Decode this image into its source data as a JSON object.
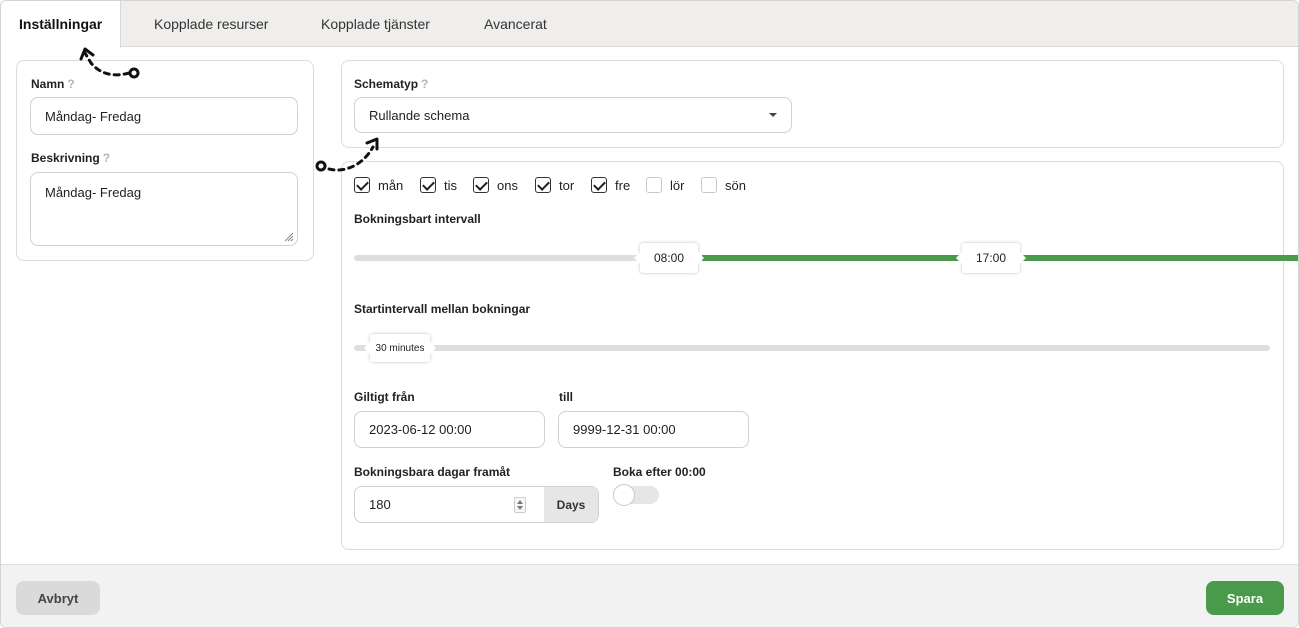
{
  "tabs": [
    {
      "label": "Inställningar",
      "active": true
    },
    {
      "label": "Kopplade resurser",
      "active": false
    },
    {
      "label": "Kopplade tjänster",
      "active": false
    },
    {
      "label": "Avancerat",
      "active": false
    }
  ],
  "help_icon": "?",
  "left": {
    "name_label": "Namn",
    "name_value": "Måndag- Fredag",
    "desc_label": "Beskrivning",
    "desc_value": "Måndag- Fredag"
  },
  "schedule": {
    "type_label": "Schematyp",
    "type_value": "Rullande schema"
  },
  "days": [
    {
      "label": "mån",
      "checked": true
    },
    {
      "label": "tis",
      "checked": true
    },
    {
      "label": "ons",
      "checked": true
    },
    {
      "label": "tor",
      "checked": true
    },
    {
      "label": "fre",
      "checked": true
    },
    {
      "label": "lör",
      "checked": false
    },
    {
      "label": "sön",
      "checked": false
    }
  ],
  "interval": {
    "label": "Bokningsbart intervall",
    "start": "08:00",
    "end": "17:00"
  },
  "start_interval": {
    "label": "Startintervall mellan bokningar",
    "value": "30 minutes"
  },
  "valid": {
    "from_label": "Giltigt från",
    "from_value": "2023-06-12 00:00",
    "to_label": "till",
    "to_value": "9999-12-31 00:00"
  },
  "days_ahead": {
    "label": "Bokningsbara dagar framåt",
    "value": "180",
    "unit": "Days"
  },
  "book_after": {
    "label": "Boka efter 00:00",
    "on": false
  },
  "footer": {
    "cancel": "Avbryt",
    "save": "Spara"
  },
  "colors": {
    "accent": "#4a9a4c",
    "tabbar": "#efeeec"
  }
}
